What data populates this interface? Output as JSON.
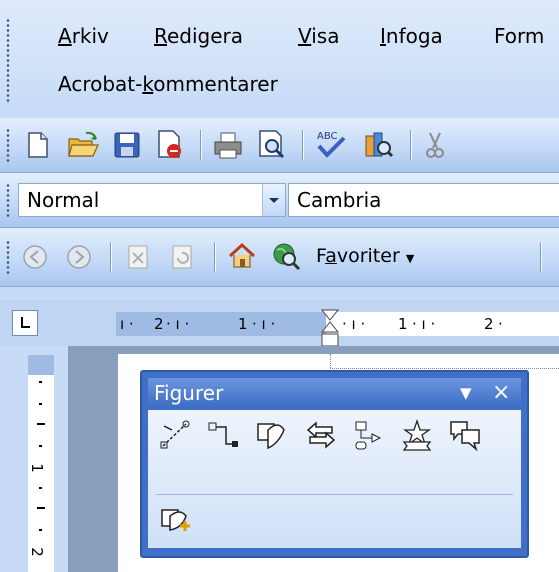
{
  "menu": {
    "items": [
      {
        "label_u": "A",
        "label_rest": "rkiv"
      },
      {
        "label_u": "R",
        "label_rest": "edigera"
      },
      {
        "label_u": "V",
        "label_rest": "isa"
      },
      {
        "label_u": "I",
        "label_rest": "nfoga"
      },
      {
        "label_u": "",
        "label_rest": "Form"
      }
    ],
    "acrobat": {
      "pre": "Acrobat-",
      "u": "k",
      "post": "ommentarer"
    }
  },
  "standard_toolbar": {
    "icons": [
      "new-document-icon",
      "open-folder-icon",
      "save-disk-icon",
      "pdf-convert-icon",
      "print-icon",
      "print-preview-icon",
      "spelling-check-icon",
      "research-icon",
      "cut-icon"
    ]
  },
  "format_toolbar": {
    "style_value": "Normal",
    "font_value": "Cambria"
  },
  "web_toolbar": {
    "favorites_pre": "F",
    "favorites_u": "a",
    "favorites_post": "voriter",
    "icons": [
      "back-icon",
      "forward-icon",
      "stop-icon",
      "refresh-icon",
      "home-icon",
      "search-web-icon"
    ]
  },
  "ruler": {
    "h_ticks": [
      "2",
      "1",
      "1",
      "2"
    ],
    "v_ticks": [
      "1",
      "2"
    ]
  },
  "shapes_toolbar": {
    "title": "Figurer",
    "menu_glyph": "▼",
    "close_glyph": "×",
    "row1_icons": [
      "connector-straight-icon",
      "connector-elbow-icon",
      "shape-flowchart-icon",
      "block-arrows-icon",
      "flowchart-icon",
      "stars-banners-icon",
      "callouts-icon"
    ],
    "row2_icons": [
      "more-autoshapes-icon"
    ]
  },
  "colors": {
    "toolbar_blue": "#c4daf7",
    "float_border": "#3f6fc7",
    "title_text": "#ffffff"
  }
}
